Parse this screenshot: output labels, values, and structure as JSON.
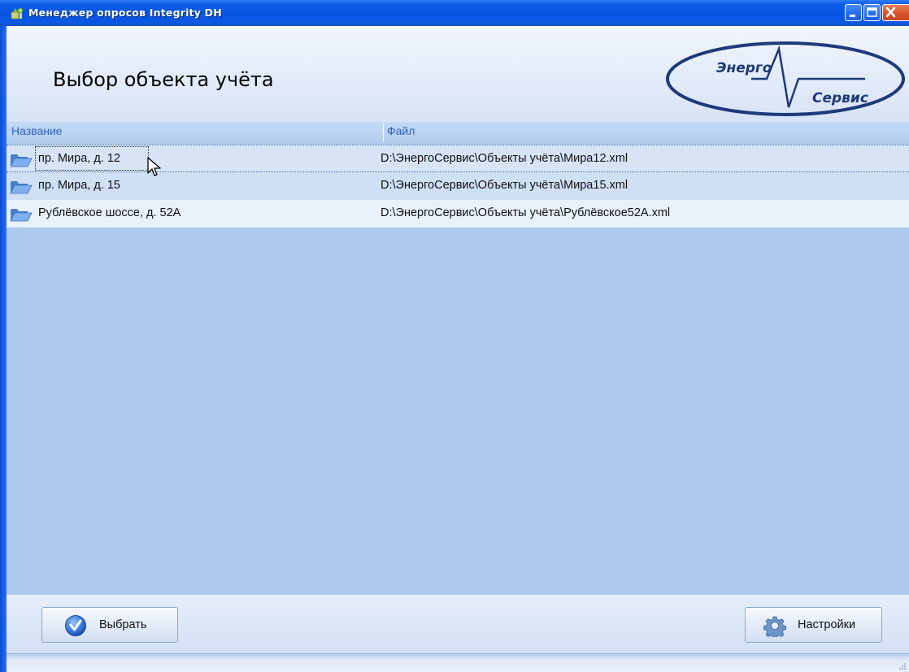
{
  "window": {
    "title": "Менеджер опросов Integrity DH",
    "accent_color": "#0654e0",
    "controls": [
      "minimize-icon",
      "maximize-icon",
      "close-icon"
    ]
  },
  "header": {
    "title": "Выбор объекта учёта",
    "logo": {
      "line1": "Энерго",
      "line2": "Сервис",
      "color": "#1f3a7a"
    }
  },
  "list": {
    "columns": [
      "Название",
      "Файл"
    ],
    "rows": [
      {
        "name": "пр. Мира, д. 12",
        "file": "D:\\ЭнергоСервис\\Объекты учёта\\Мира12.xml",
        "icon": "folder-open-icon"
      },
      {
        "name": "пр. Мира, д. 15",
        "file": "D:\\ЭнергоСервис\\Объекты учёта\\Мира15.xml",
        "icon": "folder-open-icon"
      },
      {
        "name": "Рублёвское шоссе, д. 52А",
        "file": "D:\\ЭнергоСервис\\Объекты учёта\\Рублёвское52А.xml",
        "icon": "folder-open-icon"
      }
    ]
  },
  "footer": {
    "select_label": "Выбрать",
    "select_icon": "checkmark-icon",
    "settings_label": "Настройки",
    "settings_icon": "gear-icon"
  }
}
